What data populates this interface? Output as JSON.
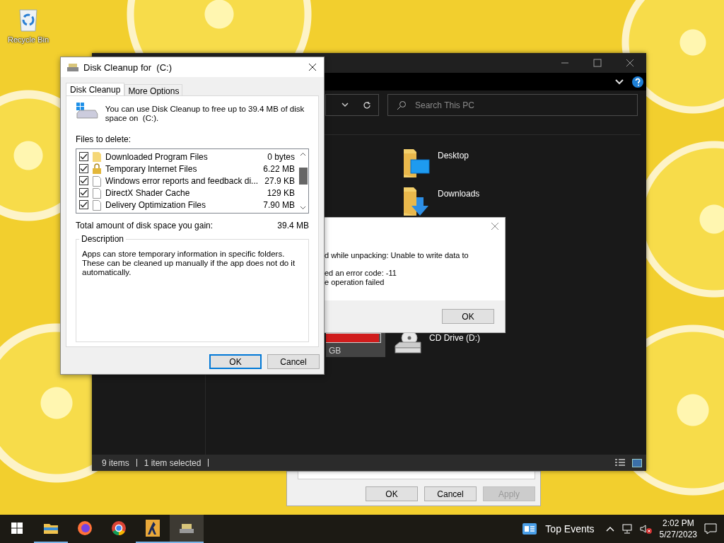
{
  "desktop_icons": [
    {
      "label": "Recycle Bin"
    }
  ],
  "properties_dialog": {
    "buttons": [
      {
        "label": "OK",
        "disabled": false
      },
      {
        "label": "Cancel",
        "disabled": false
      },
      {
        "label": "Apply",
        "disabled": true
      }
    ]
  },
  "explorer": {
    "search": {
      "placeholder": "Search This PC"
    },
    "items": [
      {
        "label": "Desktop",
        "kind": "desktop"
      },
      {
        "label": "Downloads",
        "kind": "downloads"
      }
    ],
    "drive": {
      "level": 0.97,
      "text": "GB"
    },
    "cd_drive": {
      "label": "CD Drive (D:)"
    },
    "status_bar": [
      "9 items",
      "1 item selected"
    ]
  },
  "error_dialog": {
    "lines": [
      "d while unpacking: Unable to write data to",
      "ed an error code: -11",
      "e operation failed"
    ],
    "button": "OK"
  },
  "disk_cleanup": {
    "title": "Disk Cleanup for  (C:)",
    "tabs": [
      {
        "label": "Disk Cleanup",
        "selected": true
      },
      {
        "label": "More Options",
        "selected": false
      }
    ],
    "message": "You can use Disk Cleanup to free up to 39.4 MB of disk space on  (C:).",
    "files_label": "Files to delete:",
    "files": [
      {
        "name": "Downloaded Program Files",
        "size": "0 bytes",
        "checked": true,
        "kind": "folder"
      },
      {
        "name": "Temporary Internet Files",
        "size": "6.22 MB",
        "checked": true,
        "kind": "lock"
      },
      {
        "name": "Windows error reports and feedback di...",
        "size": "27.9 KB",
        "checked": true,
        "kind": "file"
      },
      {
        "name": "DirectX Shader Cache",
        "size": "129 KB",
        "checked": true,
        "kind": "file"
      },
      {
        "name": "Delivery Optimization Files",
        "size": "7.90 MB",
        "checked": true,
        "kind": "file"
      }
    ],
    "total_label": "Total amount of disk space you gain:",
    "total": "39.4 MB",
    "description_title": "Description",
    "description": "Apps can store temporary information in specific folders. These can be cleaned up manually if the app does not do it automatically.",
    "buttons": [
      "OK",
      "Cancel"
    ]
  },
  "taskbar": {
    "apps": [
      {
        "kind": "explorer",
        "running": true,
        "active": false
      },
      {
        "kind": "firefox",
        "running": false,
        "active": false
      },
      {
        "kind": "chrome",
        "running": false,
        "active": false
      },
      {
        "kind": "game",
        "running": true,
        "active": false
      },
      {
        "kind": "cleanup",
        "running": true,
        "active": true
      }
    ],
    "widget": "Top Events",
    "time": "2:02 PM",
    "date": "5/27/2023"
  }
}
